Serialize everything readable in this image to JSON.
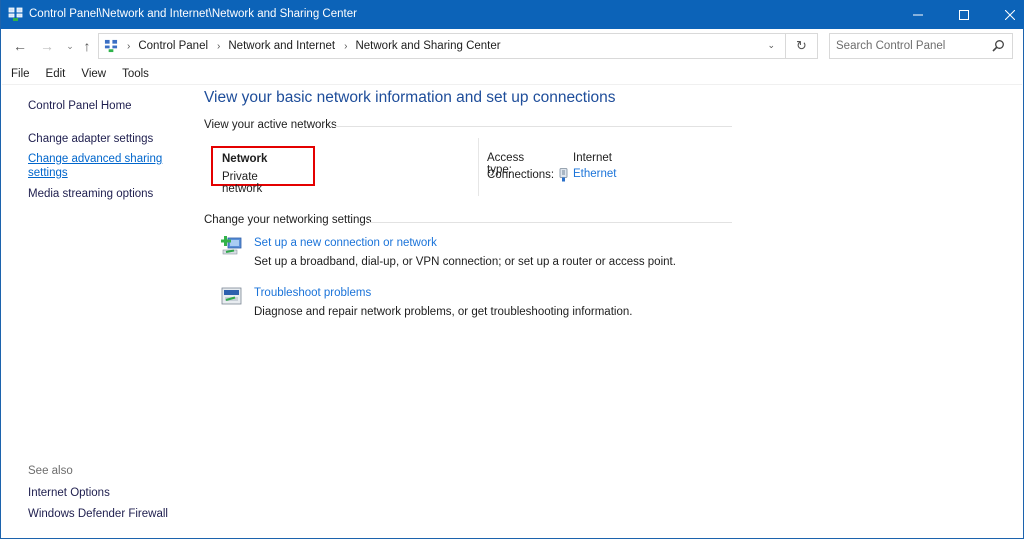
{
  "window": {
    "title": "Control Panel\\Network and Internet\\Network and Sharing Center",
    "controls": {
      "minimize": "—",
      "maximize": "☐",
      "close": "✕"
    },
    "accent_color": "#0c63b8"
  },
  "navigation": {
    "back_icon": "←",
    "forward_icon": "→",
    "recent_icon": "⌄",
    "up_icon": "↑",
    "breadcrumb": [
      "Control Panel",
      "Network and Internet",
      "Network and Sharing Center"
    ],
    "separator": "›",
    "dropdown_icon": "⌄",
    "refresh_icon": "↻",
    "search": {
      "placeholder": "Search Control Panel",
      "value": ""
    }
  },
  "menubar": [
    "File",
    "Edit",
    "View",
    "Tools"
  ],
  "sidebar": {
    "home": "Control Panel Home",
    "links": [
      {
        "label": "Change adapter settings"
      },
      {
        "label": "Change advanced sharing settings",
        "line1": "Change advanced sharing",
        "line2": "settings",
        "active": true
      },
      {
        "label": "Media streaming options"
      }
    ],
    "see_also_header": "See also",
    "see_also": [
      "Internet Options",
      "Windows Defender Firewall"
    ]
  },
  "main": {
    "title": "View your basic network information and set up connections",
    "active_networks": {
      "header": "View your active networks",
      "network_name": "Network",
      "network_type": "Private network",
      "access_type_label": "Access type:",
      "access_type_value": "Internet",
      "connections_label": "Connections:",
      "connection_name": "Ethernet"
    },
    "settings": {
      "header": "Change your networking settings",
      "tasks": [
        {
          "icon": "new-connection-icon",
          "link": "Set up a new connection or network",
          "desc": "Set up a broadband, dial-up, or VPN connection; or set up a router or access point."
        },
        {
          "icon": "troubleshoot-icon",
          "link": "Troubleshoot problems",
          "desc": "Diagnose and repair network problems, or get troubleshooting information."
        }
      ]
    }
  },
  "colors": {
    "link": "#1a73d9",
    "title": "#1e4d9a",
    "highlight_box": "#e40000"
  }
}
